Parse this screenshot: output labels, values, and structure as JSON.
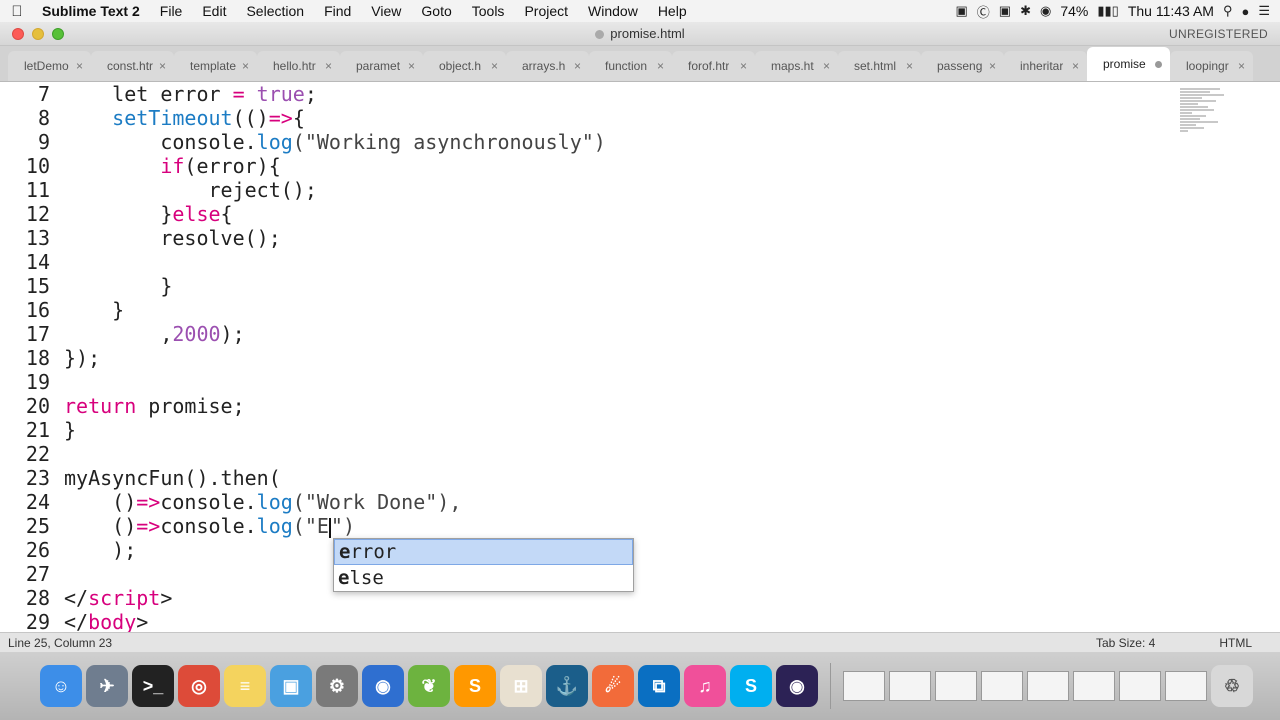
{
  "menubar": {
    "apple": "",
    "app_name": "Sublime Text 2",
    "items": [
      "File",
      "Edit",
      "Selection",
      "Find",
      "View",
      "Goto",
      "Tools",
      "Project",
      "Window",
      "Help"
    ],
    "battery": "74%",
    "time": "Thu 11:43 AM"
  },
  "window": {
    "title": "promise.html",
    "registration": "UNREGISTERED"
  },
  "tabs": [
    {
      "label": "letDemo",
      "active": false
    },
    {
      "label": "const.htr",
      "active": false
    },
    {
      "label": "template",
      "active": false
    },
    {
      "label": "hello.htr",
      "active": false
    },
    {
      "label": "paramet",
      "active": false
    },
    {
      "label": "object.h",
      "active": false
    },
    {
      "label": "arrays.h",
      "active": false
    },
    {
      "label": "function",
      "active": false
    },
    {
      "label": "forof.htr",
      "active": false
    },
    {
      "label": "maps.ht",
      "active": false
    },
    {
      "label": "set.html",
      "active": false
    },
    {
      "label": "passeng",
      "active": false
    },
    {
      "label": "inheritar",
      "active": false
    },
    {
      "label": "promise",
      "active": true
    },
    {
      "label": "loopingr",
      "active": false
    }
  ],
  "editor": {
    "line_numbers": [
      "7",
      "8",
      "9",
      "10",
      "11",
      "12",
      "13",
      "14",
      "15",
      "16",
      "17",
      "18",
      "19",
      "20",
      "21",
      "22",
      "23",
      "24",
      "25",
      "26",
      "27",
      "28",
      "29"
    ],
    "lines": [
      [
        {
          "t": "    let error ",
          "c": "plain"
        },
        {
          "t": "=",
          "c": "kw"
        },
        {
          "t": " ",
          "c": "plain"
        },
        {
          "t": "true",
          "c": "num"
        },
        {
          "t": ";",
          "c": "plain"
        }
      ],
      [
        {
          "t": "    ",
          "c": "plain"
        },
        {
          "t": "setTimeout",
          "c": "fn"
        },
        {
          "t": "(()",
          "c": "plain"
        },
        {
          "t": "=>",
          "c": "kw"
        },
        {
          "t": "{",
          "c": "plain"
        }
      ],
      [
        {
          "t": "        console.",
          "c": "plain"
        },
        {
          "t": "log",
          "c": "fn"
        },
        {
          "t": "(\"Working asynchronously\")",
          "c": "str"
        }
      ],
      [
        {
          "t": "        ",
          "c": "plain"
        },
        {
          "t": "if",
          "c": "kw"
        },
        {
          "t": "(error){",
          "c": "plain"
        }
      ],
      [
        {
          "t": "            reject();",
          "c": "plain"
        }
      ],
      [
        {
          "t": "        }",
          "c": "plain"
        },
        {
          "t": "else",
          "c": "kw"
        },
        {
          "t": "{",
          "c": "plain"
        }
      ],
      [
        {
          "t": "        resolve();",
          "c": "plain"
        }
      ],
      [
        {
          "t": "",
          "c": "plain"
        }
      ],
      [
        {
          "t": "        }",
          "c": "plain"
        }
      ],
      [
        {
          "t": "    }",
          "c": "plain"
        }
      ],
      [
        {
          "t": "        ,",
          "c": "plain"
        },
        {
          "t": "2000",
          "c": "num"
        },
        {
          "t": ");",
          "c": "plain"
        }
      ],
      [
        {
          "t": "});",
          "c": "plain"
        }
      ],
      [
        {
          "t": "",
          "c": "plain"
        }
      ],
      [
        {
          "t": "return",
          "c": "kw"
        },
        {
          "t": " promise;",
          "c": "plain"
        }
      ],
      [
        {
          "t": "}",
          "c": "plain"
        }
      ],
      [
        {
          "t": "",
          "c": "plain"
        }
      ],
      [
        {
          "t": "myAsyncFun().then(",
          "c": "plain"
        }
      ],
      [
        {
          "t": "    ()",
          "c": "plain"
        },
        {
          "t": "=>",
          "c": "kw"
        },
        {
          "t": "console.",
          "c": "plain"
        },
        {
          "t": "log",
          "c": "fn"
        },
        {
          "t": "(\"Work Done\"),",
          "c": "str"
        }
      ],
      [
        {
          "t": "    ()",
          "c": "plain"
        },
        {
          "t": "=>",
          "c": "kw"
        },
        {
          "t": "console.",
          "c": "plain"
        },
        {
          "t": "log",
          "c": "fn"
        },
        {
          "t": "(\"E",
          "c": "str"
        },
        {
          "t": "|CURSOR|",
          "c": "cursor"
        },
        {
          "t": "\")",
          "c": "str"
        }
      ],
      [
        {
          "t": "    );",
          "c": "plain"
        }
      ],
      [
        {
          "t": "",
          "c": "plain"
        }
      ],
      [
        {
          "t": "</",
          "c": "plain"
        },
        {
          "t": "script",
          "c": "tag"
        },
        {
          "t": ">",
          "c": "plain"
        }
      ],
      [
        {
          "t": "</",
          "c": "plain"
        },
        {
          "t": "body",
          "c": "tag"
        },
        {
          "t": ">",
          "c": "plain"
        }
      ]
    ]
  },
  "autocomplete": {
    "items": [
      {
        "match": "e",
        "rest": "rror",
        "selected": true
      },
      {
        "match": "e",
        "rest": "lse",
        "selected": false
      }
    ]
  },
  "statusbar": {
    "position": "Line 25, Column 23",
    "tab_size": "Tab Size: 4",
    "syntax": "HTML"
  },
  "dock": {
    "icons": [
      {
        "name": "finder-icon",
        "color": "#3d8ee8"
      },
      {
        "name": "launchpad-icon",
        "color": "#6f7d8f"
      },
      {
        "name": "terminal-icon",
        "color": "#222222"
      },
      {
        "name": "chrome-icon",
        "color": "#dd4b39"
      },
      {
        "name": "notes-icon",
        "color": "#f4d35e"
      },
      {
        "name": "preview-icon",
        "color": "#4aa0e0"
      },
      {
        "name": "system-preferences-icon",
        "color": "#7a7a7a"
      },
      {
        "name": "image-capture-icon",
        "color": "#2f6fd0"
      },
      {
        "name": "spring-icon",
        "color": "#6db33f"
      },
      {
        "name": "sublime-text-icon",
        "color": "#ff9800"
      },
      {
        "name": "calculator-icon",
        "color": "#e8e0d0"
      },
      {
        "name": "mysql-workbench-icon",
        "color": "#1b5e8a"
      },
      {
        "name": "postman-icon",
        "color": "#f26b3a"
      },
      {
        "name": "visual-studio-code-icon",
        "color": "#0a6fc2"
      },
      {
        "name": "itunes-icon",
        "color": "#f0509a"
      },
      {
        "name": "skype-icon",
        "color": "#00aff0"
      },
      {
        "name": "eclipse-icon",
        "color": "#2c2255"
      }
    ]
  }
}
